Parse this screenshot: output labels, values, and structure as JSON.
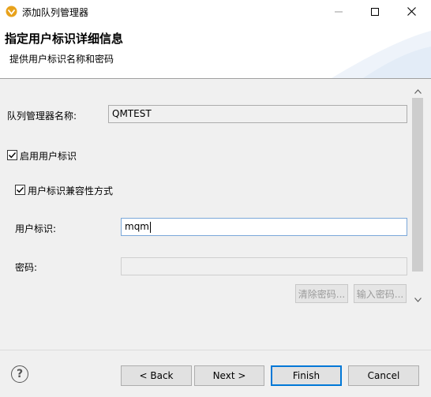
{
  "window": {
    "title": "添加队列管理器"
  },
  "banner": {
    "title": "指定用户标识详细信息",
    "description": "提供用户标识名称和密码"
  },
  "form": {
    "qmgr_label": "队列管理器名称:",
    "qmgr_value": "QMTEST",
    "enable_userid_label": "启用用户标识",
    "enable_userid_checked": true,
    "compat_mode_label": "用户标识兼容性方式",
    "compat_mode_checked": true,
    "userid_label": "用户标识:",
    "userid_value": "mqm",
    "password_label": "密码:",
    "password_value": "",
    "clear_password_label": "清除密码...",
    "enter_password_label": "输入密码..."
  },
  "footer": {
    "help_label": "?",
    "back_label": "< Back",
    "next_label": "Next >",
    "finish_label": "Finish",
    "cancel_label": "Cancel"
  }
}
